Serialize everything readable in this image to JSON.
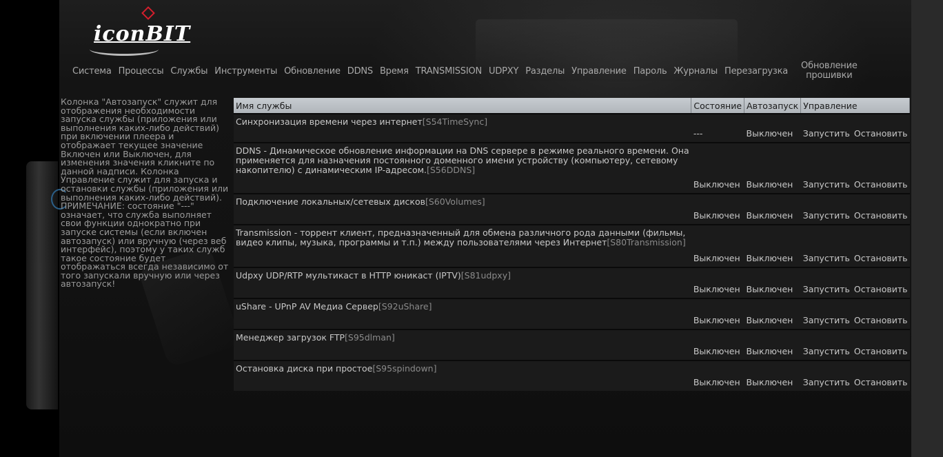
{
  "logo": {
    "text": "iconBIT"
  },
  "nav": {
    "items": [
      "Система",
      "Процессы",
      "Службы",
      "Инструменты",
      "Обновление",
      "DDNS",
      "Время",
      "TRANSMISSION",
      "UDPXY",
      "Разделы",
      "Управление",
      "Пароль",
      "Журналы",
      "Перезагрузка"
    ],
    "firmware_line1": "Обновление",
    "firmware_line2": "прошивки"
  },
  "side_note": "Колонка \"Автозапуск\" служит для отображения необходимости запуска службы (приложения или выполнения каких-либо действий) при включении плеера и отображает текущее значение Включен или Выключен, для изменения значения кликните по данной надписи. Колонка Управление служит для запуска и остановки службы (приложения или выполнения каких-либо действий). ПРИМЕЧАНИЕ: состояние \"---\" означает, что служба выполняет свои функции однократно при запуске системы (если включен автозапуск) или вручную (через веб интерфейс), поэтому у таких служб такое состояние будет отображаться всегда независимо от того запускали вручную или через автозапуск!",
  "table": {
    "headers": {
      "name": "Имя службы",
      "state": "Состояние",
      "autostart": "Автозапуск",
      "control": "Управление"
    },
    "rows": [
      {
        "name": "Синхронизация времени через интернет",
        "id": "[S54TimeSync]",
        "state": "---",
        "autostart": "Выключен",
        "start": "Запустить",
        "stop": "Остановить"
      },
      {
        "name": "DDNS - Динамическое обновление информации на DNS сервере в режиме реального времени. Она применяется для назначения постоянного доменного имени устройству (компьютеру, сетевому накопителю) с динамическим IP-адресом.",
        "id": "[S56DDNS]",
        "state": "Выключен",
        "autostart": "Выключен",
        "start": "Запустить",
        "stop": "Остановить"
      },
      {
        "name": "Подключение локальных/сетевых дисков",
        "id": "[S60Volumes]",
        "state": "Выключен",
        "autostart": "Выключен",
        "start": "Запустить",
        "stop": "Остановить"
      },
      {
        "name": "Transmission - торрент клиент, предназначенный для обмена различного рода данными (фильмы, видео клипы, музыка, программы и т.п.) между пользователями через Интернет",
        "id": "[S80Transmission]",
        "state": "Выключен",
        "autostart": "Выключен",
        "start": "Запустить",
        "stop": "Остановить"
      },
      {
        "name": "Udpxy UDP/RTP мультикаст в HTTP юникаст (IPTV)",
        "id": "[S81udpxy]",
        "state": "Выключен",
        "autostart": "Выключен",
        "start": "Запустить",
        "stop": "Остановить"
      },
      {
        "name": "uShare - UPnP AV Медиа Сервер",
        "id": "[S92uShare]",
        "state": "Выключен",
        "autostart": "Выключен",
        "start": "Запустить",
        "stop": "Остановить"
      },
      {
        "name": "Менеджер загрузок FTP",
        "id": "[S95dlman]",
        "state": "Выключен",
        "autostart": "Выключен",
        "start": "Запустить",
        "stop": "Остановить"
      },
      {
        "name": "Остановка диска при простое",
        "id": "[S95spindown]",
        "state": "Выключен",
        "autostart": "Выключен",
        "start": "Запустить",
        "stop": "Остановить"
      }
    ]
  }
}
